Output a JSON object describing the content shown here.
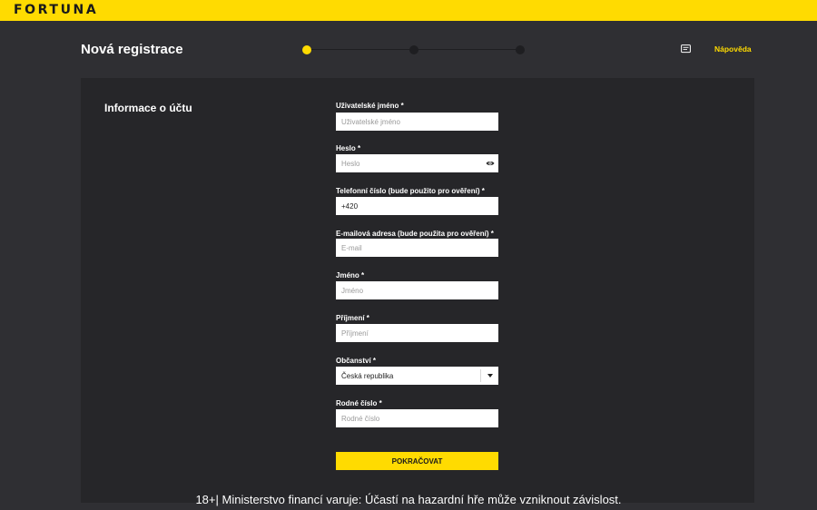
{
  "brand": {
    "logo_text": "FORTUNA",
    "accent_color": "#ffdb01"
  },
  "header": {
    "title": "Nová registrace",
    "help_label": "Nápověda",
    "help_icon": "chat-icon",
    "steps": {
      "total": 3,
      "current": 1
    }
  },
  "form": {
    "section_title": "Informace o účtu",
    "username": {
      "label": "Uživatelské jméno *",
      "placeholder": "Uživatelské jméno",
      "value": ""
    },
    "password": {
      "label": "Heslo *",
      "placeholder": "Heslo",
      "value": "",
      "toggle_icon": "eye-icon"
    },
    "phone": {
      "label": "Telefonní číslo (bude použito pro ověření) *",
      "placeholder": "",
      "value": "+420"
    },
    "email": {
      "label": "E-mailová adresa (bude použita pro ověření) *",
      "placeholder": "E-mail",
      "value": ""
    },
    "first_name": {
      "label": "Jméno *",
      "placeholder": "Jméno",
      "value": ""
    },
    "last_name": {
      "label": "Příjmení *",
      "placeholder": "Příjmení",
      "value": ""
    },
    "citizenship": {
      "label": "Občanství *",
      "selected": "Česká republika"
    },
    "birth_number": {
      "label": "Rodné číslo *",
      "placeholder": "Rodné číslo",
      "value": ""
    },
    "submit_label": "POKRAČOVAT"
  },
  "footer": {
    "warning": "18+| Ministerstvo financí varuje: Účastí na hazardní hře může vzniknout závislost."
  }
}
